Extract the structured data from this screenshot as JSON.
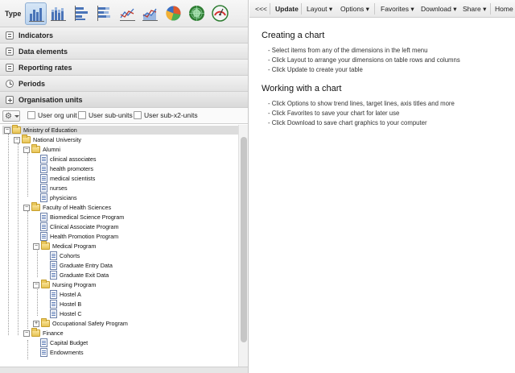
{
  "typebar": {
    "label": "Type",
    "chart_types": [
      {
        "icon": "column-chart-icon",
        "selected": true
      },
      {
        "icon": "stacked-column-chart-icon",
        "selected": false
      },
      {
        "icon": "bar-chart-icon",
        "selected": false
      },
      {
        "icon": "stacked-bar-chart-icon",
        "selected": false
      },
      {
        "icon": "line-chart-icon",
        "selected": false
      },
      {
        "icon": "area-chart-icon",
        "selected": false
      },
      {
        "icon": "pie-chart-icon",
        "selected": false
      },
      {
        "icon": "radar-chart-icon",
        "selected": false
      },
      {
        "icon": "gauge-chart-icon",
        "selected": false
      }
    ]
  },
  "accordion": {
    "indicators": "Indicators",
    "data_elements": "Data elements",
    "reporting_rates": "Reporting rates",
    "periods": "Periods",
    "organisation_units": "Organisation units"
  },
  "ou_options": {
    "user_org_unit": "User org unit",
    "user_sub_units": "User sub-units",
    "user_sub_x2_units": "User sub-x2-units"
  },
  "tree": {
    "root": "Ministry of Education",
    "national_university": "National University",
    "alumni": "Alumni",
    "clinical_associates": "clinical associates",
    "health_promoters": "health promoters",
    "medical_scientists": "medical scientists",
    "nurses": "nurses",
    "physicians": "physicians",
    "faculty": "Faculty of Health Sciences",
    "biomedical": "Biomedical Science Program",
    "clinical_associate_program": "Clinical Associate Program",
    "health_promotion": "Health Promotion Program",
    "medical_program": "Medical Program",
    "cohorts": "Cohorts",
    "graduate_entry": "Graduate Entry Data",
    "graduate_exit": "Graduate Exit Data",
    "nursing_program": "Nursing Program",
    "hostel_a": "Hostel A",
    "hostel_b": "Hostel B",
    "hostel_c": "Hostel C",
    "occupational_safety": "Occupational Safety Program",
    "finance": "Finance",
    "capital_budget": "Capital Budget",
    "endowments": "Endowments"
  },
  "toolbar": {
    "collapse": "<<<",
    "update": "Update",
    "layout": "Layout",
    "options": "Options",
    "favorites": "Favorites",
    "download": "Download",
    "share": "Share",
    "home": "Home"
  },
  "content": {
    "creating_title": "Creating a chart",
    "creating_lines": [
      "- Select items from any of the dimensions in the left menu",
      "- Click Layout to arrange your dimensions on table rows and columns",
      "- Click Update to create your table"
    ],
    "working_title": "Working with a chart",
    "working_lines": [
      "- Click Options to show trend lines, target lines, axis titles and more",
      "- Click Favorites to save your chart for later use",
      "- Click Download to save chart graphics to your computer"
    ]
  },
  "colors": {
    "folder": "#e6c455",
    "selected_row": "#dcdcdc",
    "accent_selected": "#b9d2ee"
  }
}
